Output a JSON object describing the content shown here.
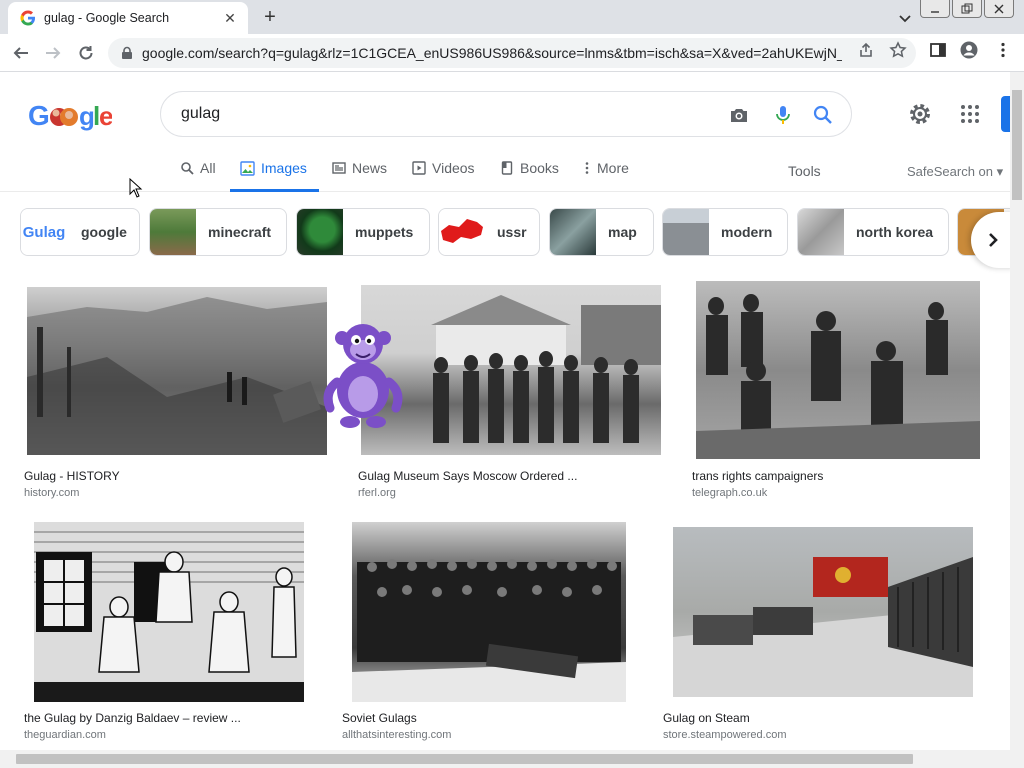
{
  "browser": {
    "tab_title": "gulag - Google Search",
    "url": "google.com/search?q=gulag&rlz=1C1GCEA_enUS986US986&source=lnms&tbm=isch&sa=X&ved=2ahUKEwjN_..."
  },
  "search": {
    "query": "gulag",
    "logo_text": "Google"
  },
  "tabs": [
    {
      "label": "All",
      "icon": "search-icon",
      "active": false
    },
    {
      "label": "Images",
      "icon": "image-icon",
      "active": true
    },
    {
      "label": "News",
      "icon": "news-icon",
      "active": false
    },
    {
      "label": "Videos",
      "icon": "video-icon",
      "active": false
    },
    {
      "label": "Books",
      "icon": "book-icon",
      "active": false
    },
    {
      "label": "More",
      "icon": "more-vert-icon",
      "active": false
    }
  ],
  "tools_label": "Tools",
  "safesearch_label": "SafeSearch on",
  "chips": [
    {
      "label": "google",
      "thumb_text": "Gulag"
    },
    {
      "label": "minecraft"
    },
    {
      "label": "muppets"
    },
    {
      "label": "ussr"
    },
    {
      "label": "map"
    },
    {
      "label": "modern"
    },
    {
      "label": "north korea"
    }
  ],
  "results": [
    {
      "title": "Gulag - HISTORY",
      "source": "history.com"
    },
    {
      "title": "Gulag Museum Says Moscow Ordered ...",
      "source": "rferl.org"
    },
    {
      "title": "trans rights campaigners",
      "source": "telegraph.co.uk"
    },
    {
      "title": "the Gulag by Danzig Baldaev – review ...",
      "source": "theguardian.com"
    },
    {
      "title": "Soviet Gulags",
      "source": "allthatsinteresting.com"
    },
    {
      "title": "Gulag on Steam",
      "source": "store.steampowered.com"
    }
  ],
  "colors": {
    "google_blue": "#1a73e8",
    "text": "#202124",
    "muted": "#70757a"
  }
}
